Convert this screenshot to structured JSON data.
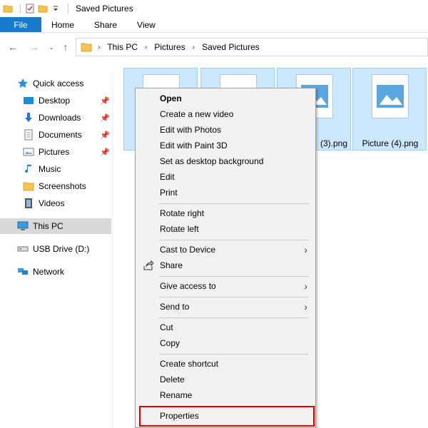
{
  "window": {
    "title": "Saved Pictures"
  },
  "ribbon": {
    "tabs": [
      "File",
      "Home",
      "Share",
      "View"
    ]
  },
  "address": {
    "crumbs": [
      "This PC",
      "Pictures",
      "Saved Pictures"
    ]
  },
  "nav": {
    "quick_access": "Quick access",
    "items": [
      "Desktop",
      "Downloads",
      "Documents",
      "Pictures",
      "Music",
      "Screenshots",
      "Videos"
    ],
    "this_pc": "This PC",
    "usb": "USB Drive (D:)",
    "network": "Network"
  },
  "files": [
    {
      "name": ""
    },
    {
      "name": ""
    },
    {
      "name": "(3).png"
    },
    {
      "name": "Picture (4).png"
    }
  ],
  "menu": {
    "open": "Open",
    "create_video": "Create a new video",
    "edit_photos": "Edit with Photos",
    "edit_paint3d": "Edit with Paint 3D",
    "set_background": "Set as desktop background",
    "edit": "Edit",
    "print": "Print",
    "rotate_right": "Rotate right",
    "rotate_left": "Rotate left",
    "cast": "Cast to Device",
    "share": "Share",
    "give_access": "Give access to",
    "send_to": "Send to",
    "cut": "Cut",
    "copy": "Copy",
    "create_shortcut": "Create shortcut",
    "delete": "Delete",
    "rename": "Rename",
    "properties": "Properties"
  },
  "colors": {
    "accent": "#1979ca",
    "selection": "#cce8ff",
    "highlight": "#e00000"
  }
}
